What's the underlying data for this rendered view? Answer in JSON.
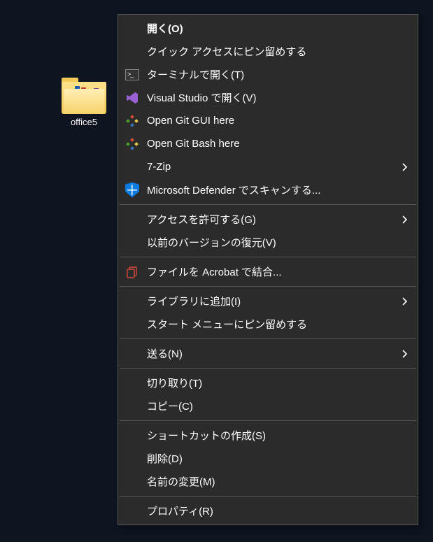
{
  "desktop": {
    "folder_label": "office5"
  },
  "menu": {
    "open": "開く(O)",
    "pin_quick_access": "クイック アクセスにピン留めする",
    "open_terminal": "ターミナルで開く(T)",
    "open_vs": "Visual Studio で開く(V)",
    "open_git_gui": "Open Git GUI here",
    "open_git_bash": "Open Git Bash here",
    "seven_zip": "7-Zip",
    "defender_scan": "Microsoft Defender でスキャンする...",
    "give_access": "アクセスを許可する(G)",
    "restore_prev": "以前のバージョンの復元(V)",
    "combine_acrobat": "ファイルを Acrobat で結合...",
    "add_library": "ライブラリに追加(I)",
    "pin_start": "スタート メニューにピン留めする",
    "send_to": "送る(N)",
    "cut": "切り取り(T)",
    "copy": "コピー(C)",
    "create_shortcut": "ショートカットの作成(S)",
    "delete": "削除(D)",
    "rename": "名前の変更(M)",
    "properties": "プロパティ(R)"
  }
}
